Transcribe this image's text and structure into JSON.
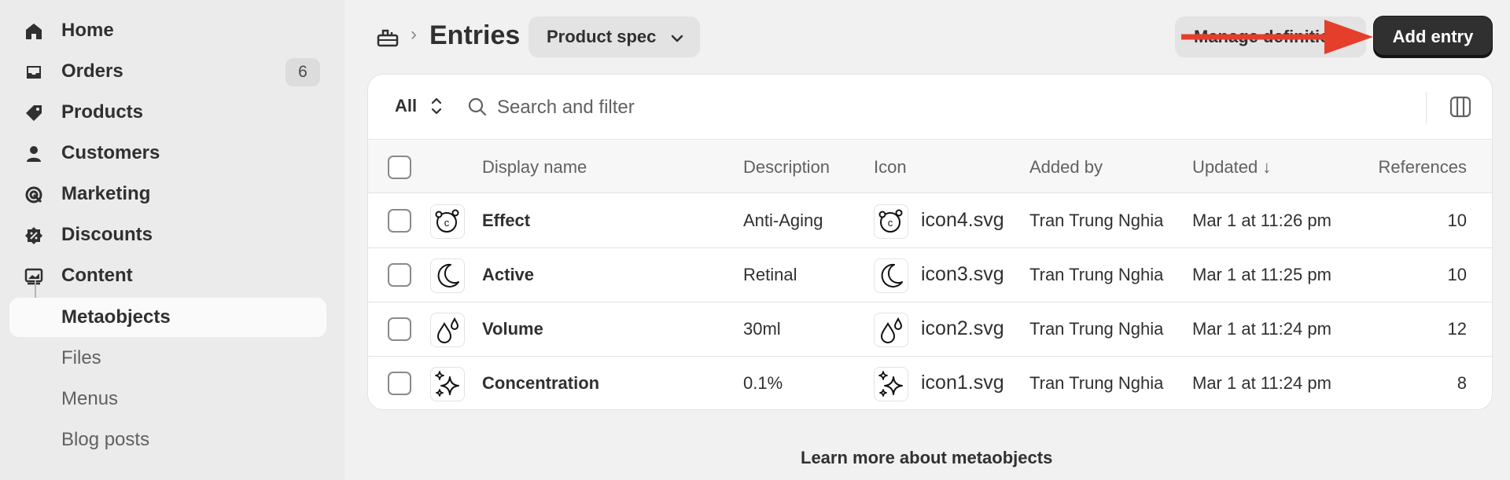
{
  "sidebar": {
    "items": [
      {
        "label": "Home",
        "icon": "home-icon"
      },
      {
        "label": "Orders",
        "icon": "inbox-icon",
        "badge": "6"
      },
      {
        "label": "Products",
        "icon": "tag-icon"
      },
      {
        "label": "Customers",
        "icon": "person-icon"
      },
      {
        "label": "Marketing",
        "icon": "target-icon"
      },
      {
        "label": "Discounts",
        "icon": "discount-icon"
      },
      {
        "label": "Content",
        "icon": "image-icon"
      },
      {
        "label": "Metaobjects",
        "active": true
      },
      {
        "label": "Files"
      },
      {
        "label": "Menus"
      },
      {
        "label": "Blog posts"
      }
    ]
  },
  "header": {
    "icon": "metaobject-icon",
    "separator": "›",
    "title": "Entries",
    "definition_select": "Product spec",
    "manage_button": "Manage definition",
    "add_button": "Add entry"
  },
  "toolbar": {
    "filter_label": "All",
    "search_placeholder": "Search and filter"
  },
  "table": {
    "headers": {
      "display_name": "Display name",
      "description": "Description",
      "icon": "Icon",
      "added_by": "Added by",
      "updated": "Updated ↓",
      "references": "References"
    },
    "rows": [
      {
        "name": "Effect",
        "description": "Anti-Aging",
        "icon_name": "orbit-c-icon",
        "icon_file": "icon4.svg",
        "added_by": "Tran Trung Nghia",
        "updated": "Mar 1 at 11:26 pm",
        "references": "10"
      },
      {
        "name": "Active",
        "description": "Retinal",
        "icon_name": "moon-icon",
        "icon_file": "icon3.svg",
        "added_by": "Tran Trung Nghia",
        "updated": "Mar 1 at 11:25 pm",
        "references": "10"
      },
      {
        "name": "Volume",
        "description": "30ml",
        "icon_name": "droplets-icon",
        "icon_file": "icon2.svg",
        "added_by": "Tran Trung Nghia",
        "updated": "Mar 1 at 11:24 pm",
        "references": "12"
      },
      {
        "name": "Concentration",
        "description": "0.1%",
        "icon_name": "sparkles-icon",
        "icon_file": "icon1.svg",
        "added_by": "Tran Trung Nghia",
        "updated": "Mar 1 at 11:24 pm",
        "references": "8"
      }
    ]
  },
  "footer": {
    "learn_more": "Learn more about metaobjects"
  },
  "colors": {
    "annotation_arrow": "#e53e2b",
    "primary_button": "#303030",
    "sidebar_bg": "#ebebeb"
  }
}
